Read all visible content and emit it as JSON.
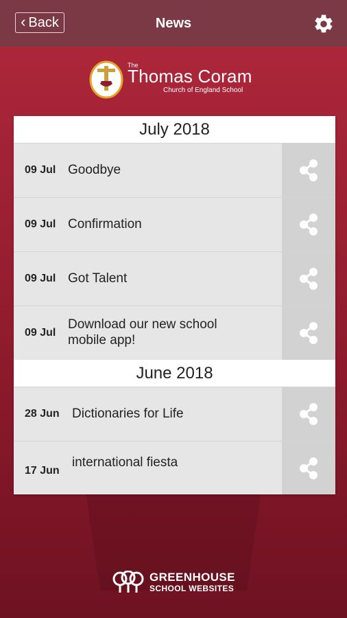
{
  "header": {
    "back_label": "Back",
    "title": "News",
    "settings_icon": "gear-icon"
  },
  "logo": {
    "prefix": "The",
    "name": "Thomas Coram",
    "subtitle": "Church of England School"
  },
  "sections": [
    {
      "month": "July 2018",
      "items": [
        {
          "date": "09 Jul",
          "title": "Goodbye"
        },
        {
          "date": "09 Jul",
          "title": "Confirmation"
        },
        {
          "date": "09 Jul",
          "title": "Got Talent"
        },
        {
          "date": "09 Jul",
          "title": "Download our new school mobile app!"
        }
      ]
    },
    {
      "month": "June 2018",
      "items": [
        {
          "date": "28 Jun",
          "title": "Dictionaries for Life"
        },
        {
          "date": "17 Jun",
          "title": "international fiesta"
        }
      ]
    }
  ],
  "share_icon": "share-icon",
  "footer": {
    "line1": "GREENHOUSE",
    "line2": "SCHOOL WEBSITES"
  },
  "colors": {
    "header": "#7a3945",
    "background": "#b1283c",
    "row": "#e6e6e6",
    "share_cell": "#d2d2d2"
  }
}
